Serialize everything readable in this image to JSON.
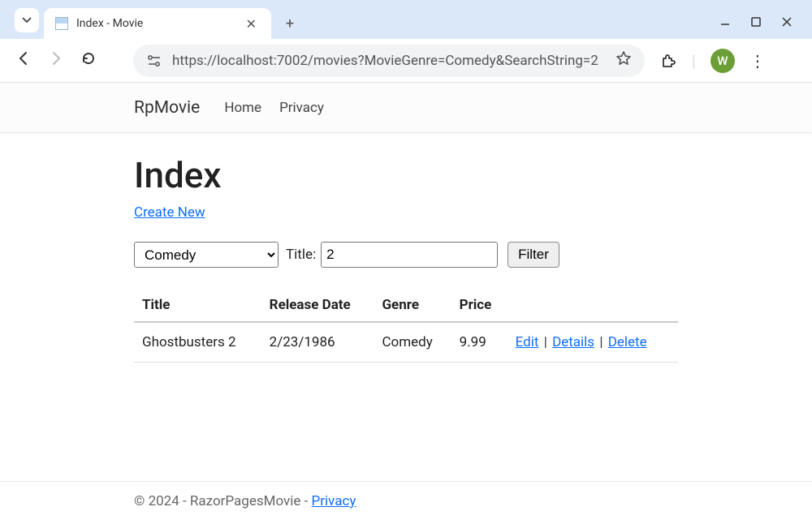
{
  "browser": {
    "tab_title": "Index - Movie",
    "url": "https://localhost:7002/movies?MovieGenre=Comedy&SearchString=2",
    "profile_letter": "W"
  },
  "nav": {
    "brand": "RpMovie",
    "links": {
      "home": "Home",
      "privacy": "Privacy"
    }
  },
  "page": {
    "heading": "Index",
    "create_link": "Create New"
  },
  "filter": {
    "genre_selected": "Comedy",
    "title_label": "Title:",
    "title_value": "2",
    "button": "Filter"
  },
  "table": {
    "headers": {
      "title": "Title",
      "release_date": "Release Date",
      "genre": "Genre",
      "price": "Price"
    },
    "rows": [
      {
        "title": "Ghostbusters 2",
        "release_date": "2/23/1986",
        "genre": "Comedy",
        "price": "9.99",
        "actions": {
          "edit": "Edit",
          "details": "Details",
          "delete": "Delete"
        }
      }
    ]
  },
  "footer": {
    "text": "© 2024 - RazorPagesMovie - ",
    "privacy": "Privacy"
  }
}
